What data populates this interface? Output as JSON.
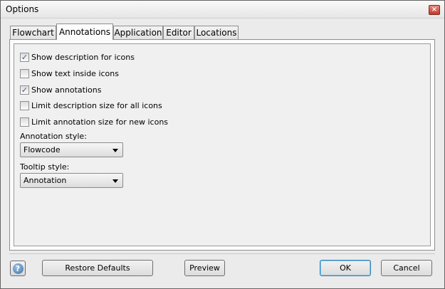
{
  "window": {
    "title": "Options",
    "close_glyph": "×"
  },
  "tabs": [
    {
      "label": "Flowchart",
      "active": false
    },
    {
      "label": "Annotations",
      "active": true
    },
    {
      "label": "Application",
      "active": false
    },
    {
      "label": "Editor",
      "active": false
    },
    {
      "label": "Locations",
      "active": false
    }
  ],
  "checkboxes": [
    {
      "label": "Show description for icons",
      "checked": true
    },
    {
      "label": "Show text inside icons",
      "checked": false
    },
    {
      "label": "Show annotations",
      "checked": true
    },
    {
      "label": "Limit description size for all icons",
      "checked": false
    },
    {
      "label": "Limit annotation size for new icons",
      "checked": false
    }
  ],
  "check_glyph": "✓",
  "annotation_style": {
    "label": "Annotation style:",
    "value": "Flowcode"
  },
  "tooltip_style": {
    "label": "Tooltip style:",
    "value": "Annotation"
  },
  "footer": {
    "help_icon": "question-mark",
    "help_glyph": "?",
    "restore_label": "Restore Defaults",
    "preview_label": "Preview",
    "ok_label": "OK",
    "cancel_label": "Cancel"
  },
  "colors": {
    "default_button_border": "#3c7fb1",
    "close_button": "#c0392b"
  }
}
